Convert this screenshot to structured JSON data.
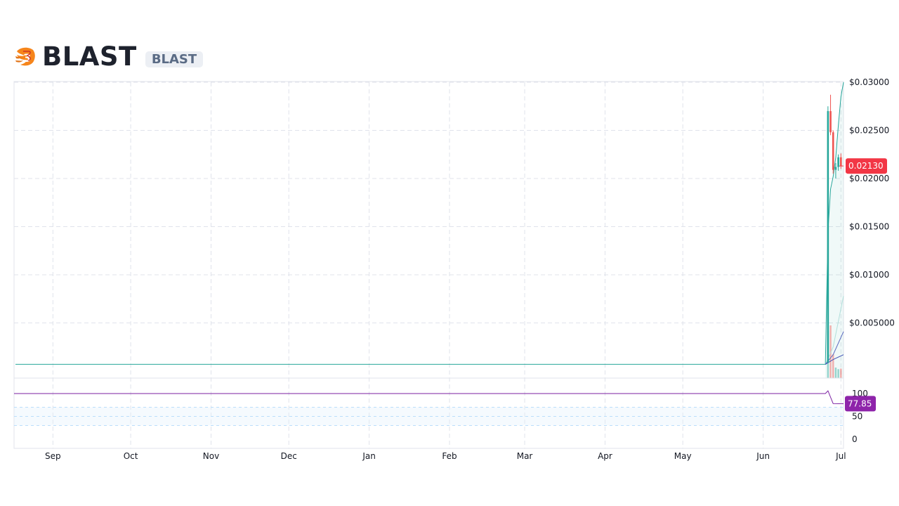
{
  "header": {
    "name": "BLAST",
    "symbol": "BLAST",
    "logo_icon": "blast-flame-logo-icon"
  },
  "colors": {
    "up": "#26a69a",
    "down": "#ef5350",
    "ma_fast": "#26a69a",
    "ma_mid": "#b2dfdb",
    "ma_slow1": "#5c6bc0",
    "ma_slow2": "#3f51b5",
    "price_badge": "#f23645",
    "rsi_line": "#7b1fa2",
    "rsi_badge": "#8e24aa",
    "grid": "#e0e3eb",
    "rsi_band": "#e3f2fd"
  },
  "chart_data": {
    "type": "candlestick",
    "x_ticks": [
      "Sep",
      "Oct",
      "Nov",
      "Dec",
      "Jan",
      "Feb",
      "Mar",
      "Apr",
      "May",
      "Jun",
      "Jul"
    ],
    "x_tick_dates": [
      "2023-09-01",
      "2023-10-01",
      "2023-11-01",
      "2023-12-01",
      "2024-01-01",
      "2024-02-01",
      "2024-03-01",
      "2024-04-01",
      "2024-05-01",
      "2024-06-01",
      "2024-07-01"
    ],
    "x_range": [
      "2023-08-17",
      "2024-07-02"
    ],
    "y_ticks": [
      "$0.03000",
      "$0.02500",
      "$0.02000",
      "$0.01500",
      "$0.01000",
      "$0.005000"
    ],
    "y_tick_values": [
      0.03,
      0.025,
      0.02,
      0.015,
      0.01,
      0.005
    ],
    "ylim": [
      0,
      0.03
    ],
    "last_price": 0.0213,
    "last_price_label": "0.02130",
    "candles": [
      {
        "date": "2024-06-26",
        "open": 0.0009,
        "high": 0.0275,
        "low": 0.0008,
        "close": 0.027
      },
      {
        "date": "2024-06-27",
        "open": 0.027,
        "high": 0.0287,
        "low": 0.0245,
        "close": 0.0248
      },
      {
        "date": "2024-06-28",
        "open": 0.0248,
        "high": 0.025,
        "low": 0.0205,
        "close": 0.0209
      },
      {
        "date": "2024-06-29",
        "open": 0.0209,
        "high": 0.0216,
        "low": 0.02,
        "close": 0.0212
      },
      {
        "date": "2024-06-30",
        "open": 0.0212,
        "high": 0.0225,
        "low": 0.0208,
        "close": 0.0222
      },
      {
        "date": "2024-07-01",
        "open": 0.0222,
        "high": 0.0226,
        "low": 0.021,
        "close": 0.0213
      }
    ],
    "volume": [
      {
        "date": "2024-06-26",
        "value": 0.9,
        "dir": "up"
      },
      {
        "date": "2024-06-27",
        "value": 1.0,
        "dir": "down"
      },
      {
        "date": "2024-06-28",
        "value": 0.45,
        "dir": "down"
      },
      {
        "date": "2024-06-29",
        "value": 0.2,
        "dir": "up"
      },
      {
        "date": "2024-06-30",
        "value": 0.17,
        "dir": "up"
      },
      {
        "date": "2024-07-01",
        "value": 0.18,
        "dir": "down"
      }
    ],
    "moving_averages": [
      {
        "color_key": "ma_fast",
        "points": [
          [
            "2024-06-25",
            0.0007
          ],
          [
            "2024-06-26",
            0.0145
          ],
          [
            "2024-06-27",
            0.0189
          ],
          [
            "2024-06-28",
            0.0202
          ],
          [
            "2024-06-29",
            0.0222
          ],
          [
            "2024-06-30",
            0.0255
          ],
          [
            "2024-07-01",
            0.0285
          ],
          [
            "2024-07-02",
            0.03
          ]
        ]
      },
      {
        "color_key": "ma_mid",
        "points": [
          [
            "2024-06-25",
            0.0007
          ],
          [
            "2024-06-28",
            0.0025
          ],
          [
            "2024-07-02",
            0.0078
          ]
        ]
      },
      {
        "color_key": "ma_slow1",
        "points": [
          [
            "2024-06-25",
            0.0007
          ],
          [
            "2024-06-28",
            0.0017
          ],
          [
            "2024-07-02",
            0.0041
          ]
        ]
      },
      {
        "color_key": "ma_slow2",
        "points": [
          [
            "2024-06-25",
            0.0007
          ],
          [
            "2024-06-28",
            0.0012
          ],
          [
            "2024-07-02",
            0.0017
          ]
        ]
      }
    ],
    "baseline_value": 0.0007,
    "rsi": {
      "y_ticks": [
        "100",
        "50",
        "0"
      ],
      "y_tick_values": [
        100,
        50,
        0
      ],
      "last_value": 77.85,
      "last_label": "77.85",
      "points": [
        [
          "2023-08-17",
          100
        ],
        [
          "2024-06-25",
          100
        ],
        [
          "2024-06-26",
          106
        ],
        [
          "2024-06-28",
          78
        ],
        [
          "2024-06-30",
          77.85
        ],
        [
          "2024-07-02",
          77.85
        ]
      ]
    }
  }
}
